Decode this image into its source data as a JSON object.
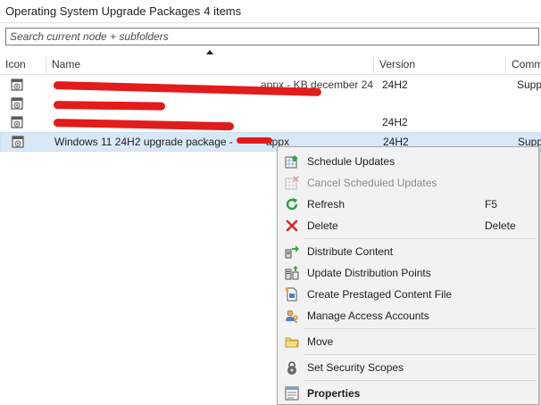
{
  "header": {
    "title": "Operating System Upgrade Packages",
    "count": "4 items"
  },
  "search": {
    "placeholder": "Search current node + subfolders"
  },
  "columns": {
    "icon": "Icon",
    "name": "Name",
    "version": "Version",
    "comments": "Comm"
  },
  "rows": [
    {
      "name": "appx - KB december 24",
      "version": "24H2",
      "comments": "Supp"
    },
    {
      "name": "",
      "version": "",
      "comments": ""
    },
    {
      "name": "",
      "version": "24H2",
      "comments": ""
    },
    {
      "name": "Windows 11 24H2 upgrade package -",
      "name_tail": "appx",
      "version": "24H2",
      "comments": "Supp"
    }
  ],
  "context_menu": {
    "schedule_updates": "Schedule Updates",
    "cancel_scheduled_updates": "Cancel Scheduled Updates",
    "refresh": "Refresh",
    "refresh_key": "F5",
    "delete": "Delete",
    "delete_key": "Delete",
    "distribute_content": "Distribute Content",
    "update_distribution_points": "Update Distribution Points",
    "create_prestaged_content_file": "Create Prestaged Content File",
    "manage_access_accounts": "Manage Access Accounts",
    "move": "Move",
    "set_security_scopes": "Set Security Scopes",
    "properties": "Properties"
  },
  "icons": {
    "package": "os-upgrade-package-icon",
    "schedule": "schedule-updates-icon",
    "cancel": "cancel-schedule-icon",
    "refresh": "refresh-icon",
    "delete": "delete-x-icon",
    "distribute": "distribute-content-icon",
    "update_dp": "update-distribution-points-icon",
    "prestaged": "prestaged-content-icon",
    "access": "manage-access-accounts-icon",
    "move": "folder-move-icon",
    "security": "security-lock-icon",
    "properties": "properties-icon"
  },
  "colors": {
    "selection": "#d9e8f7",
    "redaction": "#e21b1b",
    "menu_bg": "#f2f2f2"
  }
}
